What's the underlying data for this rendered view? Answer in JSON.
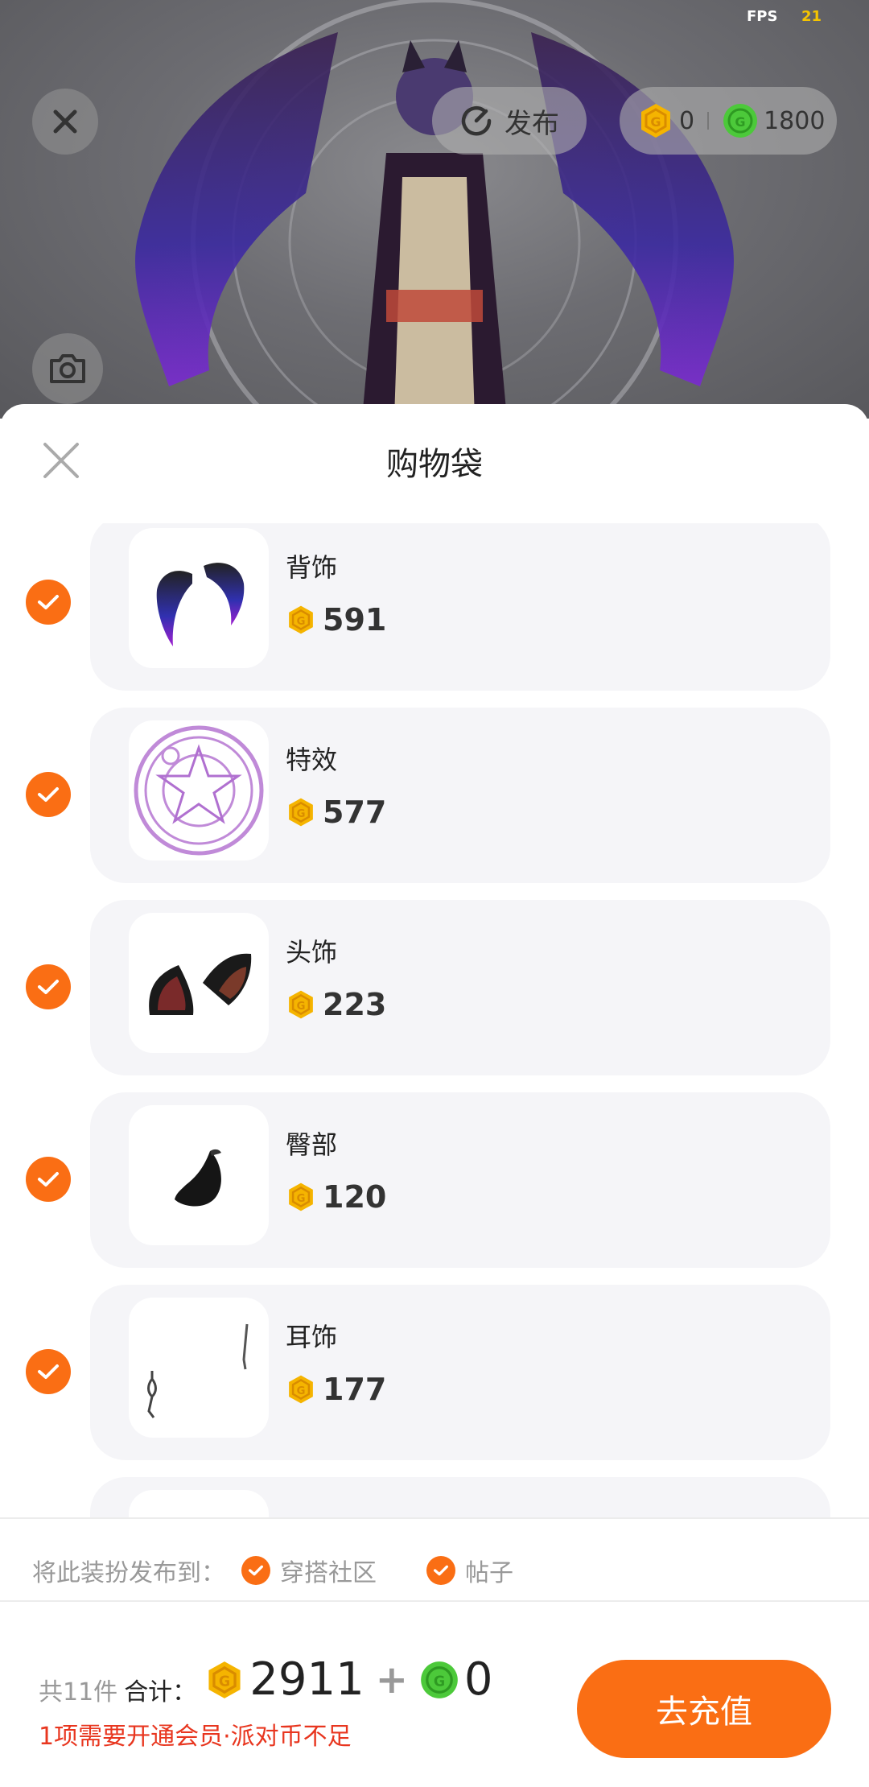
{
  "status": {
    "fps_label": "FPS",
    "fps_value": "21"
  },
  "top": {
    "publish_label": "发布",
    "gold_coins": "0",
    "green_coins": "1800"
  },
  "sheet": {
    "title": "购物袋",
    "items": [
      {
        "name": "背饰",
        "price": "591",
        "checked": true,
        "thumb": "purple-wings"
      },
      {
        "name": "特效",
        "price": "577",
        "checked": true,
        "thumb": "magic-circle"
      },
      {
        "name": "头饰",
        "price": "223",
        "checked": true,
        "thumb": "cat-ears"
      },
      {
        "name": "臀部",
        "price": "120",
        "checked": true,
        "thumb": "tail"
      },
      {
        "name": "耳饰",
        "price": "177",
        "checked": true,
        "thumb": "earrings"
      }
    ],
    "publish_to_label": "将此装扮发布到：",
    "publish_options": [
      {
        "label": "穿搭社区",
        "checked": true
      },
      {
        "label": "帖子",
        "checked": true
      }
    ]
  },
  "footer": {
    "count_text": "共11件",
    "total_label": "合计：",
    "gold_total": "2911",
    "plus": "+",
    "green_total": "0",
    "warning": "1项需要开通会员·派对币不足",
    "recharge_label": "去充值"
  },
  "colors": {
    "accent": "#fa6e14",
    "warning": "#e8361f",
    "gold": "#f5b400",
    "green": "#4cc93a"
  }
}
